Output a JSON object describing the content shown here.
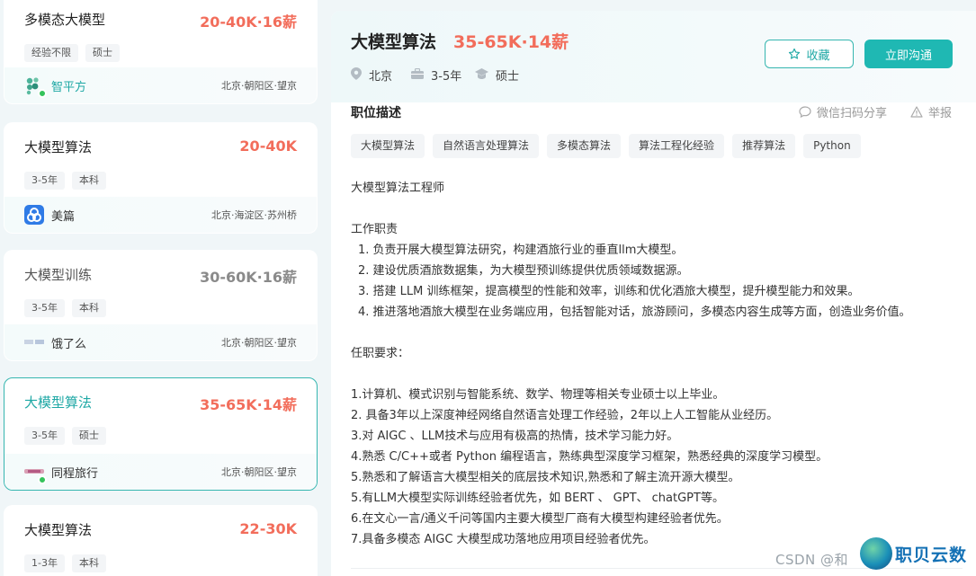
{
  "job_list": [
    {
      "title": "多模态大模型",
      "salary": "20-40K·16薪",
      "tags": [
        "经验不限",
        "硕士"
      ],
      "company": "智平方",
      "location": "北京·朝阳区·望京"
    },
    {
      "title": "大模型算法",
      "salary": "20-40K",
      "tags": [
        "3-5年",
        "本科"
      ],
      "company": "美篇",
      "location": "北京·海淀区·苏州桥"
    },
    {
      "title": "大模型训练",
      "salary": "30-60K·16薪",
      "tags": [
        "3-5年",
        "本科"
      ],
      "company": "饿了么",
      "location": "北京·朝阳区·望京"
    },
    {
      "title": "大模型算法",
      "salary": "35-65K·14薪",
      "tags": [
        "3-5年",
        "硕士"
      ],
      "company": "同程旅行",
      "location": "北京·朝阳区·望京"
    },
    {
      "title": "大模型算法",
      "salary": "22-30K",
      "tags": [
        "1-3年",
        "本科"
      ],
      "company": "",
      "location": ""
    }
  ],
  "detail": {
    "title": "大模型算法",
    "salary": "35-65K·14薪",
    "city": "北京",
    "experience": "3-5年",
    "degree": "硕士",
    "collect_label": "收藏",
    "chat_label": "立即沟通",
    "section_title": "职位描述",
    "share_label": "微信扫码分享",
    "report_label": "举报",
    "skills": [
      "大模型算法",
      "自然语言处理算法",
      "多模态算法",
      "算法工程化经验",
      "推荐算法",
      "Python"
    ],
    "lines": [
      "大模型算法工程师",
      "",
      "工作职责",
      "  1.  负责开展大模型算法研究，构建酒旅行业的垂直llm大模型。",
      "  2. 建设优质酒旅数据集，为大模型预训练提供优质领域数据源。",
      "  3. 搭建 LLM 训练框架，提高模型的性能和效率，训练和优化酒旅大模型，提升模型能力和效果。",
      "  4. 推进落地酒旅大模型在业务端应用，包括智能对话，旅游顾问，多模态内容生成等方面，创造业务价值。",
      "",
      "任职要求：",
      "",
      "1.计算机、模式识别与智能系统、数学、物理等相关专业硕士以上毕业。",
      "2. 具备3年以上深度神经网络自然语言处理工作经验，2年以上人工智能从业经历。",
      "3.对 AIGC 、LLM技术与应用有极高的热情，技术学习能力好。",
      "4.熟悉 C/C++或者 Python 编程语言，熟练典型深度学习框架，熟悉经典的深度学习模型。",
      "5.熟悉和了解语言大模型相关的底层技术知识,熟悉和了解主流开源大模型。",
      "5.有LLM大模型实际训练经验者优先，如 BERT 、 GPT、 chatGPT等。",
      "6.在文心一言/通义千问等国内主要大模型厂商有大模型构建经验者优先。",
      "7.具备多模态 AIGC 大模型成功落地应用项目经验者优先。"
    ]
  },
  "watermark": "CSDN @和",
  "brand": "职贝云数",
  "colors": {
    "accent": "#1fb8b3",
    "salary": "#f26d5b"
  }
}
